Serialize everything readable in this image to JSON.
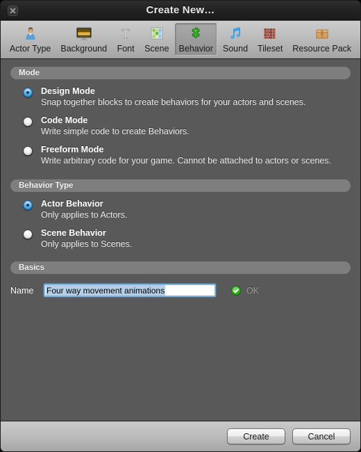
{
  "window": {
    "title": "Create New…",
    "close_icon": "close-icon"
  },
  "toolbar": {
    "items": [
      {
        "label": "Actor Type",
        "icon": "person-icon",
        "selected": false
      },
      {
        "label": "Background",
        "icon": "monitor-icon",
        "selected": false
      },
      {
        "label": "Font",
        "icon": "text-t-icon",
        "selected": false
      },
      {
        "label": "Scene",
        "icon": "tile-grid-icon",
        "selected": false
      },
      {
        "label": "Behavior",
        "icon": "puzzle-piece-icon",
        "selected": true
      },
      {
        "label": "Sound",
        "icon": "music-note-icon",
        "selected": false
      },
      {
        "label": "Tileset",
        "icon": "brick-wall-icon",
        "selected": false
      },
      {
        "label": "Resource Pack",
        "icon": "box-icon",
        "selected": false
      }
    ]
  },
  "sections": {
    "mode": {
      "header": "Mode",
      "options": [
        {
          "title": "Design Mode",
          "desc": "Snap together blocks to create behaviors for your actors and scenes.",
          "checked": true
        },
        {
          "title": "Code Mode",
          "desc": "Write simple code to create Behaviors.",
          "checked": false
        },
        {
          "title": "Freeform Mode",
          "desc": "Write arbitrary code for your game. Cannot be attached to actors or scenes.",
          "checked": false
        }
      ]
    },
    "behavior_type": {
      "header": "Behavior Type",
      "options": [
        {
          "title": "Actor Behavior",
          "desc": "Only applies to Actors.",
          "checked": true
        },
        {
          "title": "Scene Behavior",
          "desc": "Only applies to Scenes.",
          "checked": false
        }
      ]
    },
    "basics": {
      "header": "Basics",
      "name_label": "Name",
      "name_value": "Four way movement animations",
      "name_placeholder": "",
      "validation_text": "OK",
      "validation_icon": "green-check-icon"
    }
  },
  "footer": {
    "create_label": "Create",
    "cancel_label": "Cancel"
  },
  "colors": {
    "window_bg": "#595959",
    "titlebar_bg": "#222222",
    "toolbar_bg": "#bfbfbf",
    "section_header_bg": "#7e7e7e",
    "radio_selected": "#2f8fd4",
    "selection_highlight": "#b5cfe8",
    "ok_green": "#3cb52a",
    "ok_text": "#9b9b9b"
  }
}
